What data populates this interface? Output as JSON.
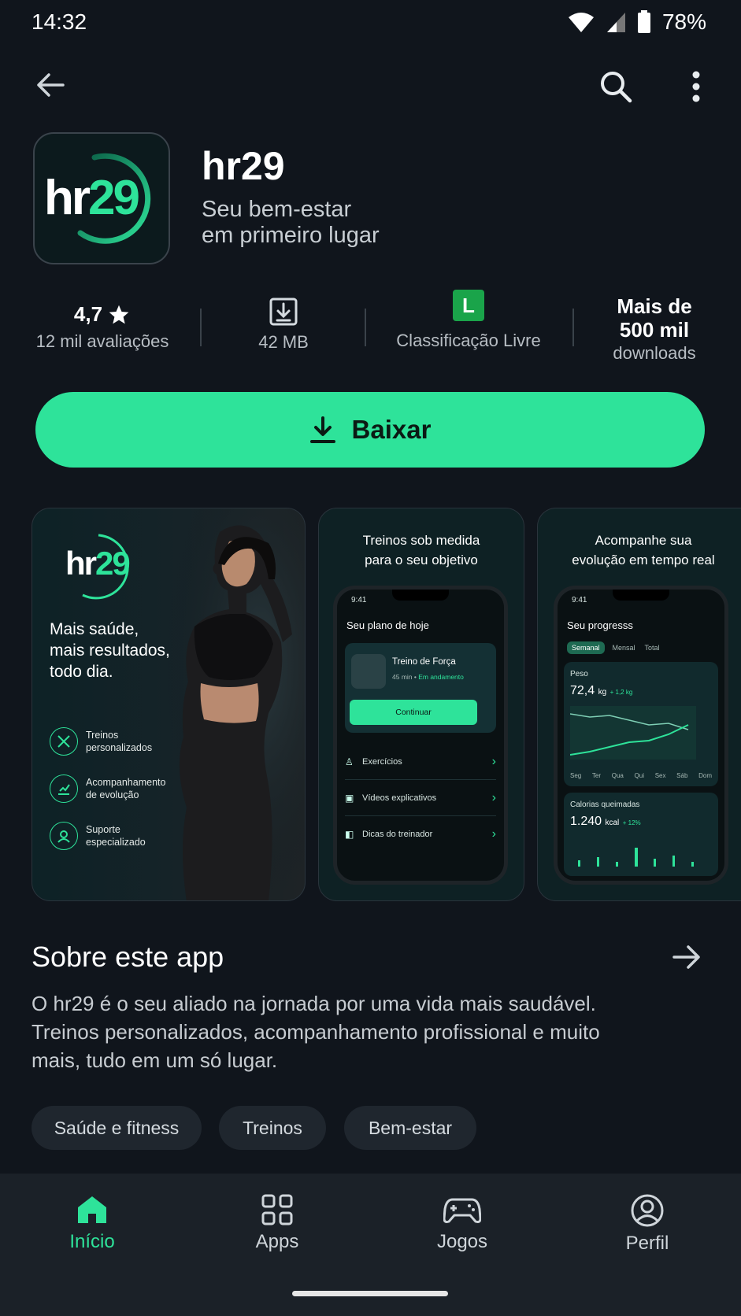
{
  "status_bar": {
    "time": "14:32",
    "battery": "78%"
  },
  "top_bar": {
    "back_icon": "arrow-left-icon",
    "search_icon": "search-icon",
    "menu_icon": "more-vert-icon"
  },
  "app": {
    "icon_text_hr": "hr",
    "icon_text_29": "29",
    "name": "hr29",
    "tagline_line1": "Seu bem-estar",
    "tagline_line2": "em primeiro lugar"
  },
  "stats": {
    "rating": "4,7",
    "rating_label": "12 mil avaliações",
    "size": "42 MB",
    "content_rating_badge": "L",
    "content_rating_label": "Classificação Livre",
    "downloads_line1": "Mais de",
    "downloads_line2": "500 mil",
    "downloads_label": "downloads"
  },
  "install_button": {
    "label": "Baixar"
  },
  "screenshots": {
    "s1": {
      "logo_hr": "hr",
      "logo_29": "29",
      "headline_1": "Mais saúde,",
      "headline_2": "mais resultados,",
      "headline_3": "todo dia.",
      "features": [
        {
          "line1": "Treinos",
          "line2": "personalizados"
        },
        {
          "line1": "Acompanhamento",
          "line2": "de evolução"
        },
        {
          "line1": "Suporte",
          "line2": "especializado"
        }
      ]
    },
    "s2": {
      "caption_1": "Treinos sob medida",
      "caption_2": "para o seu objetivo",
      "phone_time": "9:41",
      "header": "Seu plano de hoje",
      "card_title": "Treino de Força",
      "card_meta_time": "45 min",
      "card_meta_status": "Em andamento",
      "continue_label": "Continuar",
      "list": [
        "Exercícios",
        "Vídeos explicativos",
        "Dicas do treinador"
      ]
    },
    "s3": {
      "caption_1": "Acompanhe sua",
      "caption_2": "evolução em tempo real",
      "phone_time": "9:41",
      "header": "Seu progresss",
      "tabs": [
        "Semanal",
        "Mensal",
        "Total"
      ],
      "weight_label": "Peso",
      "weight_value": "72,4",
      "weight_unit": "kg",
      "weight_delta": "+ 1,2 kg",
      "days": [
        "Seg",
        "Ter",
        "Qua",
        "Qui",
        "Sex",
        "Sáb",
        "Dom"
      ],
      "calories_label": "Calorias queimadas",
      "calories_value": "1.240",
      "calories_unit": "kcal",
      "calories_delta": "+ 12%"
    }
  },
  "about": {
    "title": "Sobre este app",
    "description": "O hr29 é o seu aliado na jornada por uma vida mais saudável. Treinos personalizados, acompanhamento profissional e muito mais, tudo em um só lugar."
  },
  "chips": [
    "Saúde e fitness",
    "Treinos",
    "Bem-estar"
  ],
  "bottom_nav": [
    {
      "label": "Início",
      "icon": "home-icon",
      "active": true
    },
    {
      "label": "Apps",
      "icon": "apps-grid-icon",
      "active": false
    },
    {
      "label": "Jogos",
      "icon": "gamepad-icon",
      "active": false
    },
    {
      "label": "Perfil",
      "icon": "profile-icon",
      "active": false
    }
  ],
  "colors": {
    "accent": "#2ee39a",
    "background": "#10151c",
    "nav_background": "#1b2128"
  }
}
